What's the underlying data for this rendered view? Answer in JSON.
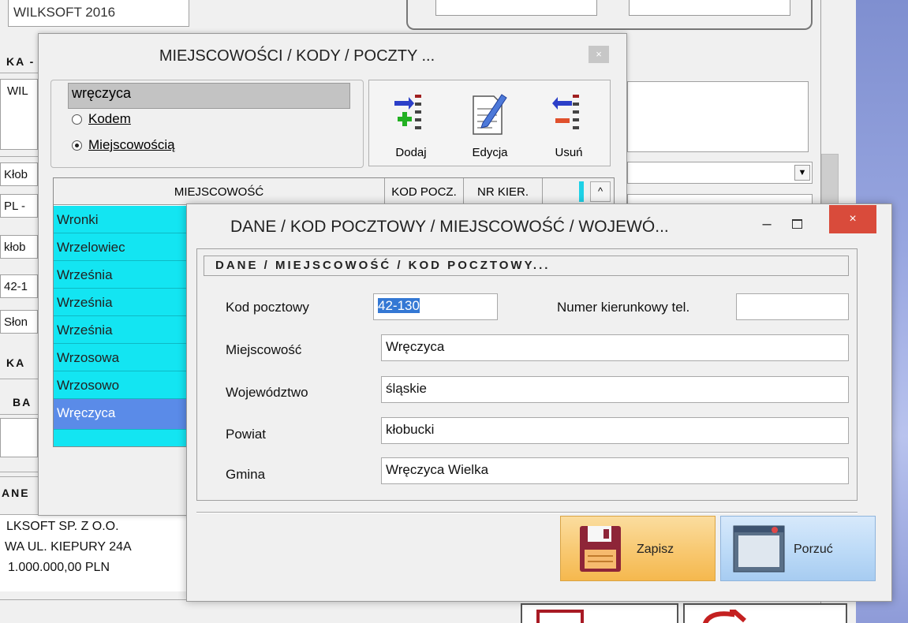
{
  "background": {
    "company_field": "WILKSOFT 2016",
    "section_label_1": "KA -",
    "field_1": "WIL",
    "field_2": "Kłob",
    "field_3": "PL -",
    "field_4": "kłob",
    "field_5": "42-1",
    "field_6": "Słon",
    "section_label_2": "KA",
    "section_label_3": "BA",
    "section_label_4": "ANE",
    "footer_line_1": "LKSOFT SP. Z O.O.",
    "footer_line_2": "WA UL. KIEPURY 24A",
    "footer_line_3": "1.000.000,00 PLN"
  },
  "places_dialog": {
    "title": "MIEJSCOWOŚCI / KODY / POCZTY ...",
    "close_label": "×",
    "search_value": "wręczyca",
    "radio_code_label": "Kodem",
    "radio_place_label": "Miejscowością",
    "tools": {
      "add_label": "Dodaj",
      "edit_label": "Edycja",
      "delete_label": "Usuń"
    },
    "grid": {
      "columns": [
        "MIEJSCOWOŚĆ",
        "KOD POCZ.",
        "NR KIER."
      ],
      "scroll_up": "^",
      "rows": [
        "Wronki",
        "Wrzelowiec",
        "Września",
        "Września",
        "Września",
        "Wrzosowa",
        "Wrzosowo",
        "Wręczyca"
      ],
      "selected_row": "Wręczyca"
    }
  },
  "postal_dialog": {
    "title": "DANE / KOD POCZTOWY / MIEJSCOWOŚĆ / WOJEWÓ...",
    "minimize_label": "–",
    "close_label": "×",
    "section_header": "DANE  / MIEJSCOWOŚĆ / KOD POCZTOWY...",
    "fields": {
      "postal_code_label": "Kod pocztowy",
      "postal_code_value": "42-130",
      "phone_prefix_label": "Numer kierunkowy tel.",
      "phone_prefix_value": "",
      "place_label": "Miejscowość",
      "place_value": "Wręczyca",
      "voivodeship_label": "Województwo",
      "voivodeship_value": "śląskie",
      "county_label": "Powiat",
      "county_value": "kłobucki",
      "commune_label": "Gmina",
      "commune_value": "Wręczyca Wielka"
    },
    "save_label": "Zapisz",
    "cancel_label": "Porzuć"
  }
}
